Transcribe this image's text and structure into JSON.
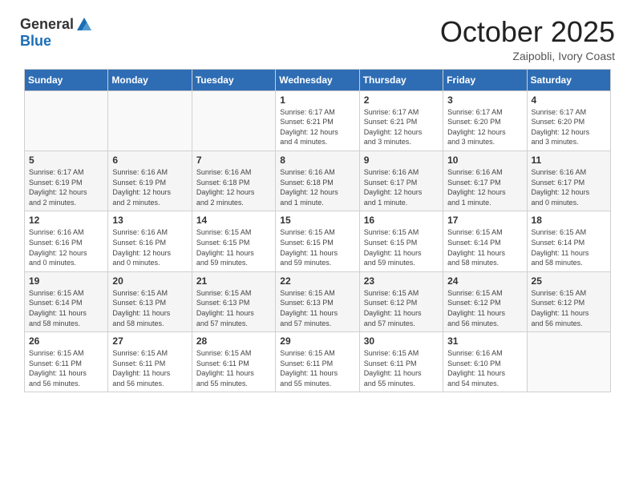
{
  "header": {
    "logo_general": "General",
    "logo_blue": "Blue",
    "month": "October 2025",
    "location": "Zaipobli, Ivory Coast"
  },
  "weekdays": [
    "Sunday",
    "Monday",
    "Tuesday",
    "Wednesday",
    "Thursday",
    "Friday",
    "Saturday"
  ],
  "weeks": [
    {
      "days": [
        {
          "num": "",
          "info": ""
        },
        {
          "num": "",
          "info": ""
        },
        {
          "num": "",
          "info": ""
        },
        {
          "num": "1",
          "info": "Sunrise: 6:17 AM\nSunset: 6:21 PM\nDaylight: 12 hours\nand 4 minutes."
        },
        {
          "num": "2",
          "info": "Sunrise: 6:17 AM\nSunset: 6:21 PM\nDaylight: 12 hours\nand 3 minutes."
        },
        {
          "num": "3",
          "info": "Sunrise: 6:17 AM\nSunset: 6:20 PM\nDaylight: 12 hours\nand 3 minutes."
        },
        {
          "num": "4",
          "info": "Sunrise: 6:17 AM\nSunset: 6:20 PM\nDaylight: 12 hours\nand 3 minutes."
        }
      ]
    },
    {
      "days": [
        {
          "num": "5",
          "info": "Sunrise: 6:17 AM\nSunset: 6:19 PM\nDaylight: 12 hours\nand 2 minutes."
        },
        {
          "num": "6",
          "info": "Sunrise: 6:16 AM\nSunset: 6:19 PM\nDaylight: 12 hours\nand 2 minutes."
        },
        {
          "num": "7",
          "info": "Sunrise: 6:16 AM\nSunset: 6:18 PM\nDaylight: 12 hours\nand 2 minutes."
        },
        {
          "num": "8",
          "info": "Sunrise: 6:16 AM\nSunset: 6:18 PM\nDaylight: 12 hours\nand 1 minute."
        },
        {
          "num": "9",
          "info": "Sunrise: 6:16 AM\nSunset: 6:17 PM\nDaylight: 12 hours\nand 1 minute."
        },
        {
          "num": "10",
          "info": "Sunrise: 6:16 AM\nSunset: 6:17 PM\nDaylight: 12 hours\nand 1 minute."
        },
        {
          "num": "11",
          "info": "Sunrise: 6:16 AM\nSunset: 6:17 PM\nDaylight: 12 hours\nand 0 minutes."
        }
      ]
    },
    {
      "days": [
        {
          "num": "12",
          "info": "Sunrise: 6:16 AM\nSunset: 6:16 PM\nDaylight: 12 hours\nand 0 minutes."
        },
        {
          "num": "13",
          "info": "Sunrise: 6:16 AM\nSunset: 6:16 PM\nDaylight: 12 hours\nand 0 minutes."
        },
        {
          "num": "14",
          "info": "Sunrise: 6:15 AM\nSunset: 6:15 PM\nDaylight: 11 hours\nand 59 minutes."
        },
        {
          "num": "15",
          "info": "Sunrise: 6:15 AM\nSunset: 6:15 PM\nDaylight: 11 hours\nand 59 minutes."
        },
        {
          "num": "16",
          "info": "Sunrise: 6:15 AM\nSunset: 6:15 PM\nDaylight: 11 hours\nand 59 minutes."
        },
        {
          "num": "17",
          "info": "Sunrise: 6:15 AM\nSunset: 6:14 PM\nDaylight: 11 hours\nand 58 minutes."
        },
        {
          "num": "18",
          "info": "Sunrise: 6:15 AM\nSunset: 6:14 PM\nDaylight: 11 hours\nand 58 minutes."
        }
      ]
    },
    {
      "days": [
        {
          "num": "19",
          "info": "Sunrise: 6:15 AM\nSunset: 6:14 PM\nDaylight: 11 hours\nand 58 minutes."
        },
        {
          "num": "20",
          "info": "Sunrise: 6:15 AM\nSunset: 6:13 PM\nDaylight: 11 hours\nand 58 minutes."
        },
        {
          "num": "21",
          "info": "Sunrise: 6:15 AM\nSunset: 6:13 PM\nDaylight: 11 hours\nand 57 minutes."
        },
        {
          "num": "22",
          "info": "Sunrise: 6:15 AM\nSunset: 6:13 PM\nDaylight: 11 hours\nand 57 minutes."
        },
        {
          "num": "23",
          "info": "Sunrise: 6:15 AM\nSunset: 6:12 PM\nDaylight: 11 hours\nand 57 minutes."
        },
        {
          "num": "24",
          "info": "Sunrise: 6:15 AM\nSunset: 6:12 PM\nDaylight: 11 hours\nand 56 minutes."
        },
        {
          "num": "25",
          "info": "Sunrise: 6:15 AM\nSunset: 6:12 PM\nDaylight: 11 hours\nand 56 minutes."
        }
      ]
    },
    {
      "days": [
        {
          "num": "26",
          "info": "Sunrise: 6:15 AM\nSunset: 6:11 PM\nDaylight: 11 hours\nand 56 minutes."
        },
        {
          "num": "27",
          "info": "Sunrise: 6:15 AM\nSunset: 6:11 PM\nDaylight: 11 hours\nand 56 minutes."
        },
        {
          "num": "28",
          "info": "Sunrise: 6:15 AM\nSunset: 6:11 PM\nDaylight: 11 hours\nand 55 minutes."
        },
        {
          "num": "29",
          "info": "Sunrise: 6:15 AM\nSunset: 6:11 PM\nDaylight: 11 hours\nand 55 minutes."
        },
        {
          "num": "30",
          "info": "Sunrise: 6:15 AM\nSunset: 6:11 PM\nDaylight: 11 hours\nand 55 minutes."
        },
        {
          "num": "31",
          "info": "Sunrise: 6:16 AM\nSunset: 6:10 PM\nDaylight: 11 hours\nand 54 minutes."
        },
        {
          "num": "",
          "info": ""
        }
      ]
    }
  ]
}
